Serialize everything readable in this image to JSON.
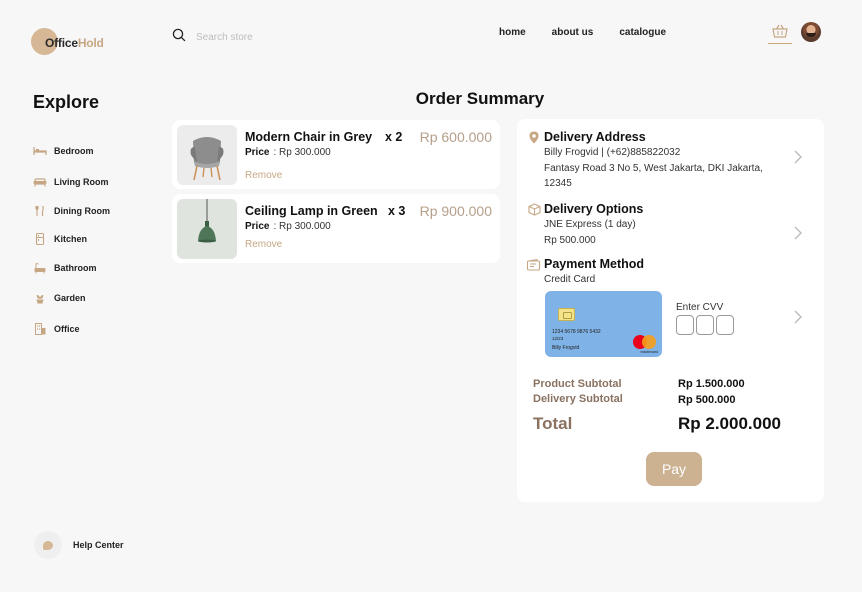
{
  "brand": {
    "name_part1": "Office",
    "name_part2": "Hold",
    "accent": "#c7a783"
  },
  "search": {
    "placeholder": "Search store"
  },
  "nav": {
    "items": [
      "home",
      "about us",
      "catalogue"
    ]
  },
  "sidebar": {
    "title": "Explore",
    "items": [
      {
        "label": "Bedroom",
        "icon": "bed-icon"
      },
      {
        "label": "Living Room",
        "icon": "sofa-icon"
      },
      {
        "label": "Dining Room",
        "icon": "utensils-icon"
      },
      {
        "label": "Kitchen",
        "icon": "fridge-icon"
      },
      {
        "label": "Bathroom",
        "icon": "bathtub-icon"
      },
      {
        "label": "Garden",
        "icon": "plant-icon"
      },
      {
        "label": "Office",
        "icon": "building-icon"
      }
    ],
    "help": "Help Center"
  },
  "page_title": "Order Summary",
  "cart_items": [
    {
      "name": "Modern Chair in Grey",
      "qty": "x 2",
      "total": "Rp 600.000",
      "price_label": "Price",
      "price": ": Rp 300.000",
      "remove": "Remove"
    },
    {
      "name": "Ceiling Lamp in Green",
      "qty": "x 3",
      "total": "Rp 900.000",
      "price_label": "Price",
      "price": ": Rp 300.000",
      "remove": "Remove"
    }
  ],
  "delivery_address": {
    "title": "Delivery Address",
    "line1": "Billy Frogvid | (+62)885822032",
    "line2": "Fantasy Road 3 No 5, West Jakarta, DKI Jakarta, 12345"
  },
  "delivery_options": {
    "title": "Delivery Options",
    "line1": "JNE Express (1 day)",
    "line2": "Rp 500.000"
  },
  "payment": {
    "title": "Payment Method",
    "method": "Credit Card",
    "card_number": "1234 5678 9876 5432",
    "card_exp": "12/23",
    "card_name": "Billy Frogvid",
    "card_brand": "mastercard",
    "cvv_label": "Enter CVV"
  },
  "summary": {
    "product_label": "Product Subtotal",
    "product_value": "Rp 1.500.000",
    "delivery_label": "Delivery Subtotal",
    "delivery_value": "Rp 500.000",
    "total_label": "Total",
    "total_value": "Rp 2.000.000"
  },
  "pay_button": "Pay"
}
